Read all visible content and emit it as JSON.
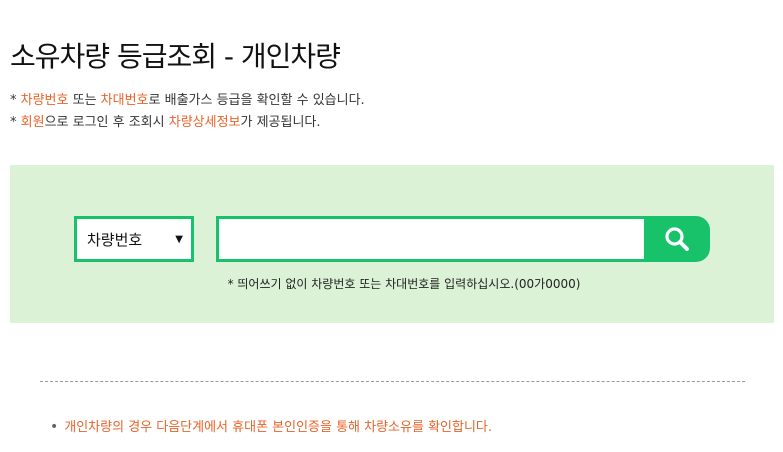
{
  "page": {
    "title": "소유차량 등급조회 - 개인차량"
  },
  "notes": [
    {
      "prefix": "* ",
      "hl1": "차량번호",
      "mid": " 또는 ",
      "hl2": "차대번호",
      "suffix": "로 배출가스 등급을 확인할 수 있습니다."
    },
    {
      "prefix": "* ",
      "hl1": "회원",
      "mid": "으로 로그인 후 조회시 ",
      "hl2": "차량상세정보",
      "suffix": "가 제공됩니다."
    }
  ],
  "search": {
    "select_value": "차량번호",
    "input_value": "",
    "input_placeholder": "",
    "hint": "* 띄어쓰기 없이 차량번호 또는 차대번호를 입력하십시오.(00가0000)"
  },
  "footer_note": {
    "bullet": "•",
    "text": "개인차량의 경우 다음단계에서 휴대폰 본인인증을 통해 차량소유를 확인합니다."
  },
  "colors": {
    "accent_green": "#18c26a",
    "panel_bg": "#dcf2d6",
    "highlight_orange": "#e8632a"
  },
  "icons": {
    "select_arrow": "triangle-down-icon",
    "search": "search-icon"
  }
}
